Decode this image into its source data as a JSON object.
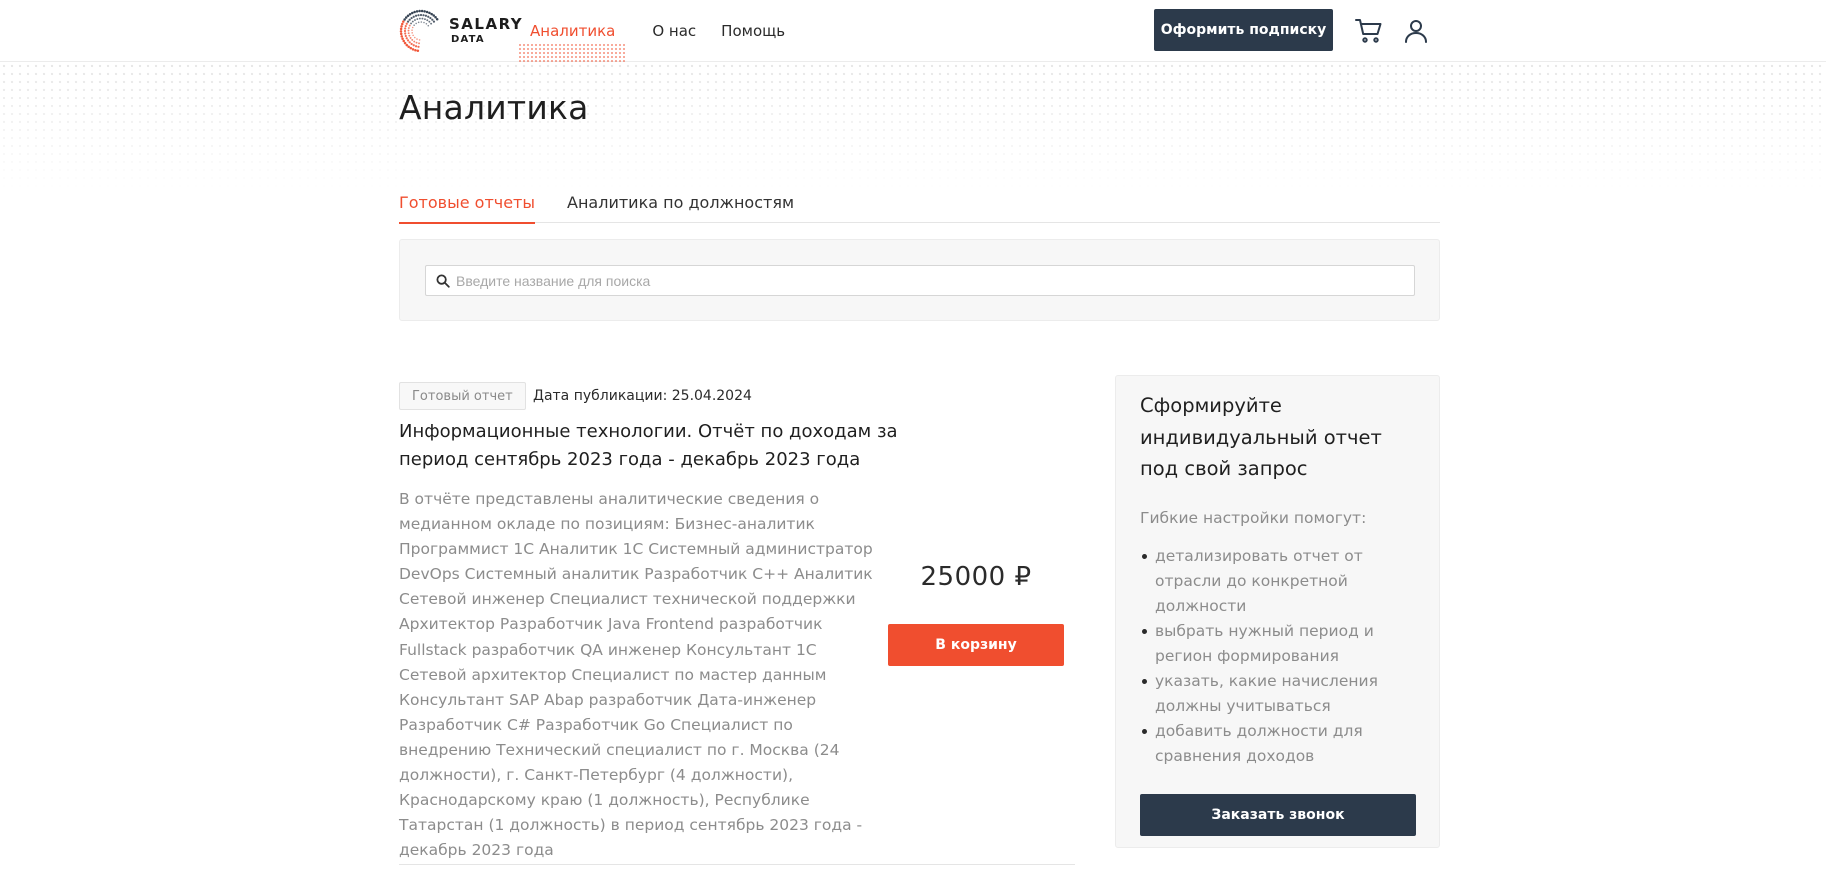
{
  "header": {
    "logo": {
      "line1": "SALARY",
      "line2": "DATA"
    },
    "nav": [
      {
        "label": "Аналитика",
        "active": true
      },
      {
        "label": "О нас",
        "active": false
      },
      {
        "label": "Помощь",
        "active": false
      }
    ],
    "subscribe_label": "Оформить подписку",
    "cart_icon": "cart-icon",
    "user_icon": "user-icon"
  },
  "page": {
    "title": "Аналитика"
  },
  "tabs": [
    {
      "label": "Готовые отчеты",
      "active": true
    },
    {
      "label": "Аналитика по должностям",
      "active": false
    }
  ],
  "search": {
    "placeholder": "Введите название для поиска",
    "value": "",
    "icon": "search-icon"
  },
  "report": {
    "badge": "Готовый отчет",
    "pub_date": "Дата публикации: 25.04.2024",
    "title": "Информационные технологии. Отчёт по доходам за период сентябрь 2023 года - декабрь 2023 года",
    "description": "В отчёте представлены аналитические сведения о медианном окладе по позициям: Бизнес-аналитик Программист 1С Аналитик 1С Системный администратор DevOps Системный аналитик Разработчик C++ Аналитик Сетевой инженер Специалист технической поддержки Архитектор Разработчик Java Frontend разработчик Fullstack разработчик QA инженер Консультант 1С Сетевой архитектор Специалист по мастер данным Консультант SAP Abap разработчик Дата-инженер Разработчик C# Разработчик Go Специалист по внедрению Технический специалист по г. Москва (24 должности), г. Санкт-Петербург (4 должности), Краснодарскому краю (1 должность), Республике Татарстан (1 должность) в период сентябрь 2023 года - декабрь 2023 года",
    "price": "25000 ₽",
    "cart_label": "В корзину"
  },
  "promo": {
    "title": "Сформируйте индивидуальный отчет под свой запрос",
    "subtitle": "Гибкие настройки помогут:",
    "items": [
      "детализировать отчет от отрасли до конкретной должности",
      "выбрать нужный период и регион формирования",
      "указать, какие начисления должны учитываться",
      "добавить должности для сравнения доходов"
    ],
    "call_label": "Заказать звонок"
  },
  "colors": {
    "accent": "#f04e2f",
    "dark_button": "#2c3a4b",
    "muted_text": "#8c8c8c"
  }
}
